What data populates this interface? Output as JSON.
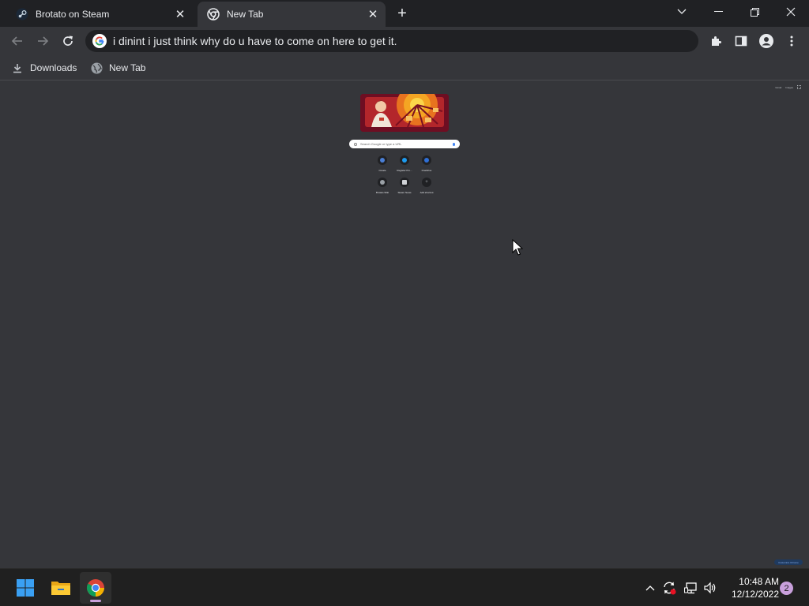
{
  "tabs": [
    {
      "title": "Brotato on Steam",
      "icon": "steam-icon",
      "active": false
    },
    {
      "title": "New Tab",
      "icon": "chrome-icon",
      "active": true
    }
  ],
  "omnibox": {
    "text": "i dinint i just think why do u have to come on here to get it.",
    "icon": "google-icon"
  },
  "bookmarks": [
    {
      "label": "Downloads",
      "icon": "download-icon"
    },
    {
      "label": "New Tab",
      "icon": "globe-icon"
    }
  ],
  "ntp": {
    "corner_links": [
      "Gmail",
      "Images"
    ],
    "search_placeholder": "Search Google or type a URL",
    "shortcuts": [
      {
        "label": "Create",
        "color": "#4a7fd6"
      },
      {
        "label": "Register Pro...",
        "color": "#1d9bf0"
      },
      {
        "label": "OneDrive",
        "color": "#2f6fd6"
      },
      {
        "label": "Brotato Wiki",
        "color": "#9aa0a6"
      },
      {
        "label": "Steam News",
        "color": "#cfd2d6"
      },
      {
        "label": "Add shortcut",
        "color": "#9aa0a6"
      }
    ],
    "customize_label": "Customize Chrome"
  },
  "taskbar": {
    "apps": [
      {
        "name": "start",
        "icon": "windows-icon"
      },
      {
        "name": "file-explorer",
        "icon": "folder-icon"
      },
      {
        "name": "chrome",
        "icon": "chrome-icon",
        "active": true
      }
    ],
    "time": "10:48 AM",
    "date": "12/12/2022",
    "notifications": "2"
  },
  "colors": {
    "chrome_dark": "#202124",
    "chrome_mid": "#35363a",
    "taskbar": "#202020",
    "accent": "#c9a0dc"
  }
}
